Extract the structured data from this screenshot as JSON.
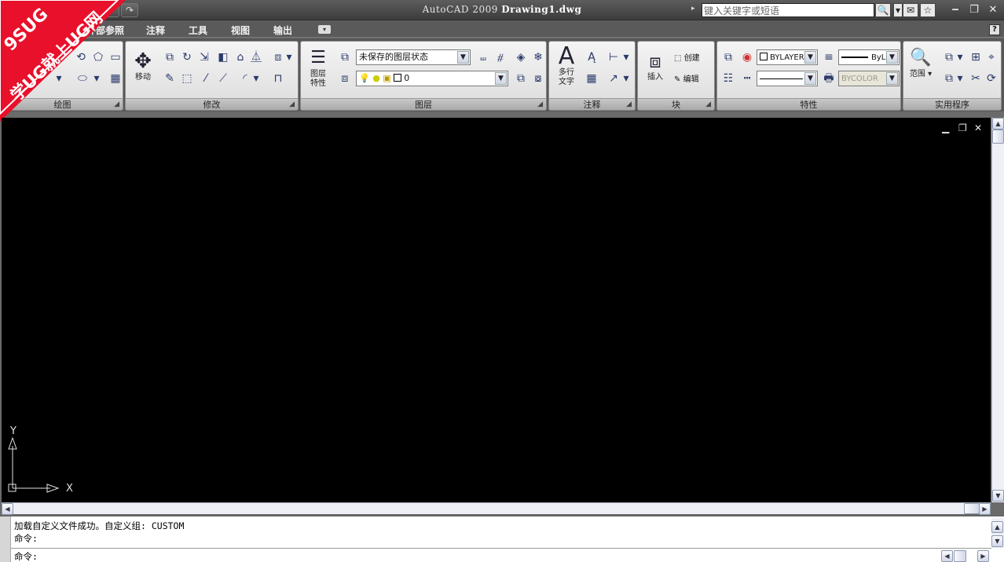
{
  "app": {
    "title": "AutoCAD 2009",
    "document": "Drawing1.dwg",
    "search_placeholder": "键入关键字或短语"
  },
  "watermark": {
    "line1": "9SUG",
    "line2": "学UG就上UG网"
  },
  "tabs": [
    {
      "label": "外部参照"
    },
    {
      "label": "注释"
    },
    {
      "label": "工具"
    },
    {
      "label": "视图"
    },
    {
      "label": "输出"
    }
  ],
  "ribbon": {
    "draw": {
      "title": "绘图"
    },
    "modify": {
      "title": "修改",
      "move_label": "移动"
    },
    "layers": {
      "title": "图层",
      "properties_label_1": "图层",
      "properties_label_2": "特性",
      "layer_state": "未保存的图层状态",
      "current_layer": "0"
    },
    "annotation": {
      "title": "注释",
      "mtext_label_1": "多行",
      "mtext_label_2": "文字"
    },
    "block": {
      "title": "块",
      "insert_label": "插入",
      "create_label": "创建",
      "edit_label": "编辑"
    },
    "properties": {
      "title": "特性",
      "color": "BYLAYER",
      "lineweight": "ByL",
      "plotstyle": "BYCOLOR"
    },
    "utilities": {
      "title": "实用程序",
      "range_label": "范围"
    }
  },
  "ucs": {
    "x_label": "X",
    "y_label": "Y"
  },
  "command": {
    "history": [
      "加载自定义文件成功。自定义组: CUSTOM",
      "命令:"
    ],
    "prompt": "命令:",
    "input_value": ""
  }
}
